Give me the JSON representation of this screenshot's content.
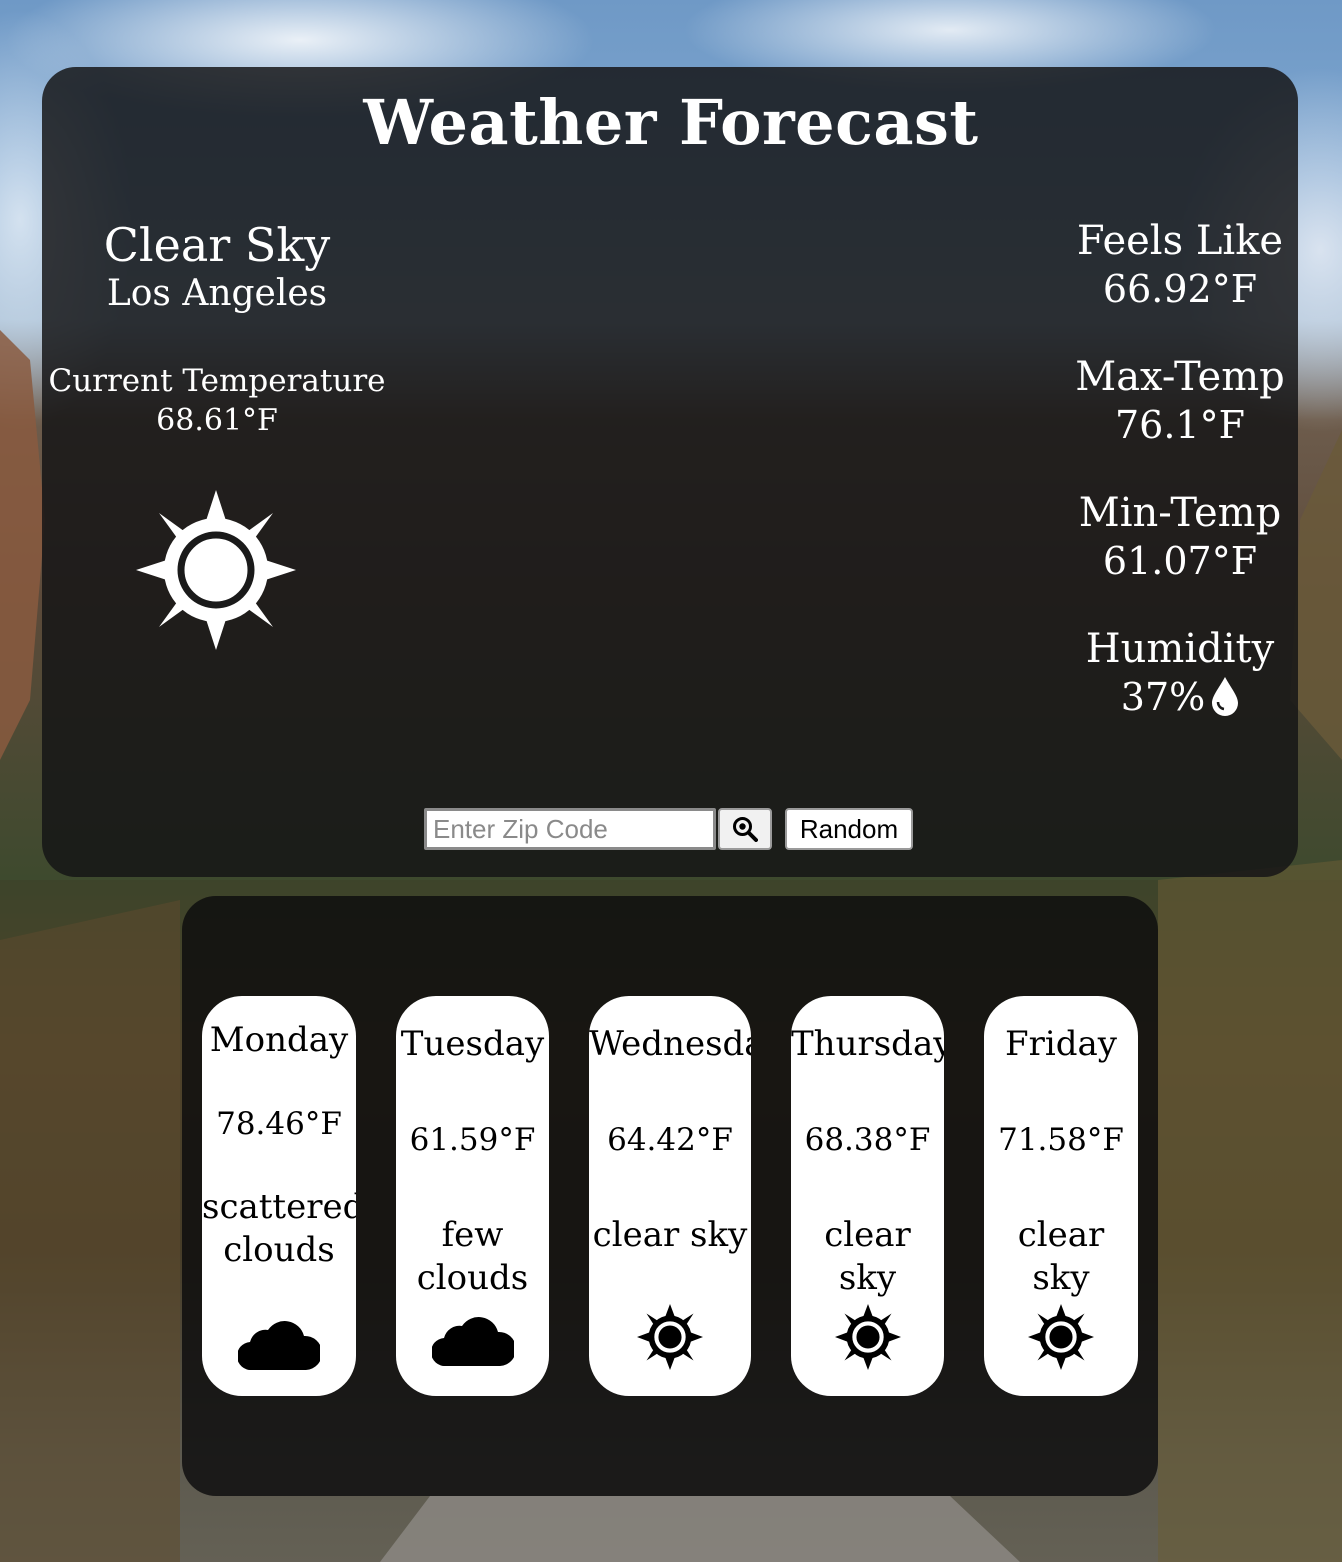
{
  "header": {
    "title": "Weather Forecast"
  },
  "current": {
    "condition": "Clear Sky",
    "city": "Los Angeles",
    "temp_label": "Current Temperature",
    "temp_value": "68.61°F",
    "icon": "sun-icon"
  },
  "stats": [
    {
      "label": "Feels Like",
      "value": "66.92°F"
    },
    {
      "label": "Max-Temp",
      "value": "76.1°F"
    },
    {
      "label": "Min-Temp",
      "value": "61.07°F"
    },
    {
      "label": "Humidity",
      "value": "37%",
      "icon": "water-drop-icon"
    }
  ],
  "search": {
    "placeholder": "Enter Zip Code",
    "value": "",
    "search_icon": "magnifier-icon",
    "random_label": "Random"
  },
  "forecast": [
    {
      "day": "Monday",
      "temp": "78.46°F",
      "desc_line1": "scattered",
      "desc_line2": "clouds",
      "icon": "cloud-icon"
    },
    {
      "day": "Tuesday",
      "temp": "61.59°F",
      "desc_line1": "few clouds",
      "desc_line2": "",
      "icon": "cloud-icon"
    },
    {
      "day": "Wednesday",
      "temp": "64.42°F",
      "desc_line1": "clear sky",
      "desc_line2": "",
      "icon": "sun-icon"
    },
    {
      "day": "Thursday",
      "temp": "68.38°F",
      "desc_line1": "clear sky",
      "desc_line2": "",
      "icon": "sun-icon"
    },
    {
      "day": "Friday",
      "temp": "71.58°F",
      "desc_line1": "clear sky",
      "desc_line2": "",
      "icon": "sun-icon"
    }
  ],
  "colors": {
    "panel": "#141416",
    "card": "#ffffff",
    "text_light": "#ffffff",
    "text_dark": "#000000"
  }
}
